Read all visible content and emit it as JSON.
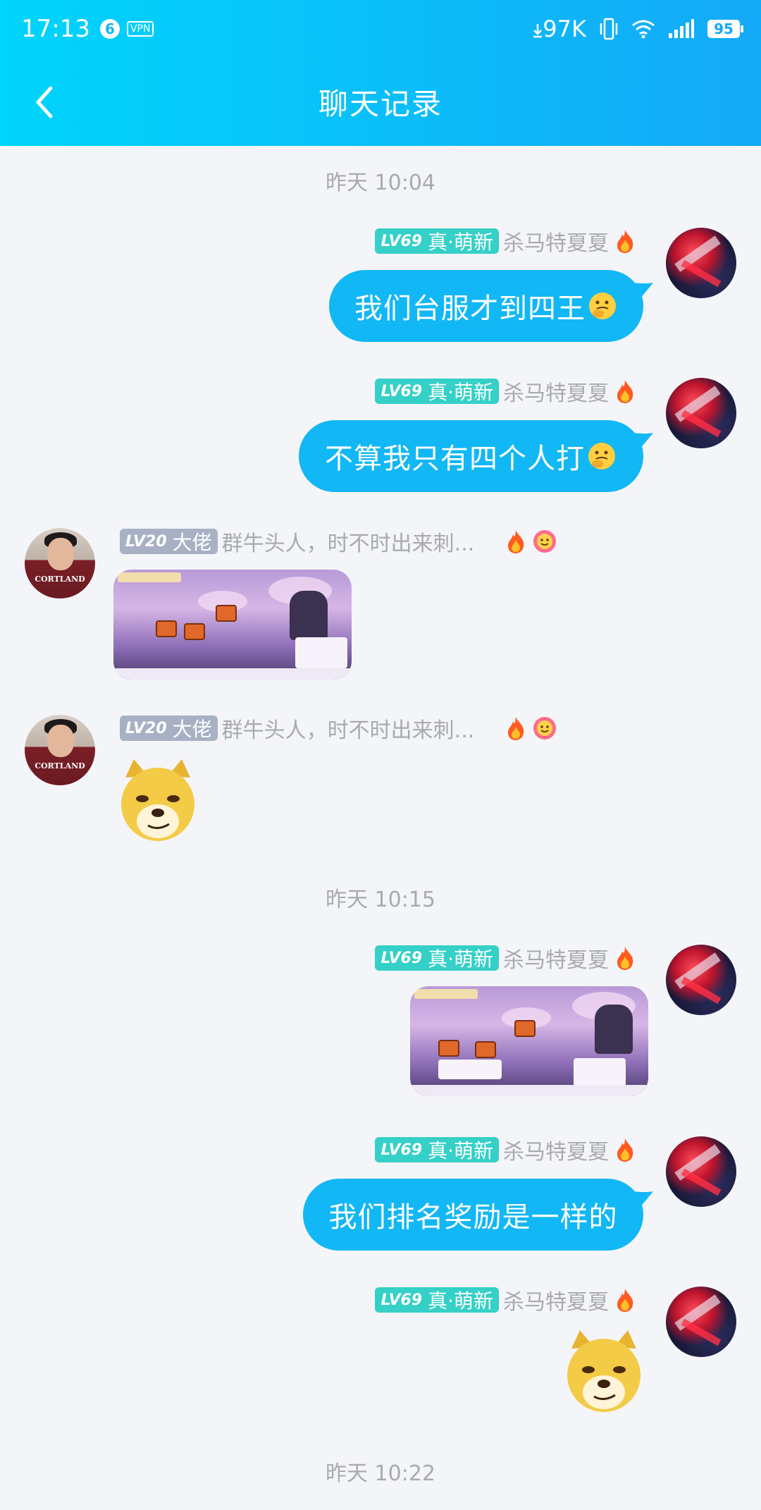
{
  "status_bar": {
    "time": "17:13",
    "notif_count": "6",
    "vpn": "VPN",
    "speed": "97K",
    "battery": "95"
  },
  "nav": {
    "title": "聊天记录"
  },
  "timestamps": [
    "昨天 10:04",
    "昨天 10:15",
    "昨天 10:22"
  ],
  "me": {
    "level": "LV69",
    "title": "真·萌新",
    "name": "杀马特夏夏"
  },
  "other": {
    "level": "LV20",
    "title": "大佬",
    "name": "群牛头人，时不时出来刺...",
    "shirt_text": "CORTLAND"
  },
  "messages": [
    {
      "sender": "me",
      "type": "text",
      "text": "我们台服才到四王",
      "emoji": "thinking-emoji"
    },
    {
      "sender": "me",
      "type": "text",
      "text": "不算我只有四个人打",
      "emoji": "thinking-emoji"
    },
    {
      "sender": "other",
      "type": "image",
      "image": "game-screenshot"
    },
    {
      "sender": "other",
      "type": "sticker",
      "sticker": "doge-sticker"
    },
    {
      "sender": "me",
      "type": "image",
      "image": "game-screenshot"
    },
    {
      "sender": "me",
      "type": "text",
      "text": "我们排名奖励是一样的"
    },
    {
      "sender": "me",
      "type": "sticker",
      "sticker": "doge-sticker"
    }
  ],
  "colors": {
    "header_start": "#00d5fb",
    "header_end": "#14a9f7",
    "bubble": "#12b7f5",
    "badge_teal": "#35d0c7",
    "badge_gray": "#a8b0c4"
  }
}
